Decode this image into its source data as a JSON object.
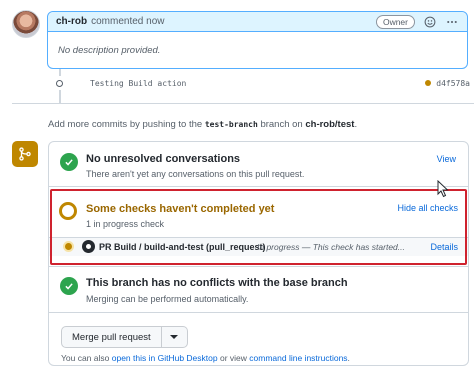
{
  "comment": {
    "author": "ch-rob",
    "action": "commented now",
    "badge": "Owner",
    "body": "No description provided."
  },
  "commit": {
    "message": "Testing Build action",
    "sha": "d4f578a",
    "status_color": "#bf8700"
  },
  "add_commits": {
    "prefix": "Add more commits by pushing to the",
    "branch": "test-branch",
    "middle": "branch on",
    "repo": "ch-rob/test",
    "suffix": "."
  },
  "conversations": {
    "title": "No unresolved conversations",
    "subtitle": "There aren't yet any conversations on this pull request.",
    "link": "View"
  },
  "checks": {
    "title": "Some checks haven't completed yet",
    "subtitle": "1 in progress check",
    "link": "Hide all checks",
    "items": [
      {
        "name": "PR Build / build-and-test (pull_request)",
        "description": "In progress — This check has started...",
        "details": "Details"
      }
    ]
  },
  "conflicts": {
    "title": "This branch has no conflicts with the base branch",
    "subtitle": "Merging can be performed automatically."
  },
  "merge": {
    "button": "Merge pull request",
    "note_prefix": "You can also",
    "desktop_link": "open this in GitHub Desktop",
    "note_middle": "or view",
    "cli_link": "command line instructions",
    "note_suffix": "."
  },
  "colors": {
    "success": "#2da44e",
    "pending": "#bf8700",
    "highlight": "#cf222e",
    "link": "#0969da"
  }
}
